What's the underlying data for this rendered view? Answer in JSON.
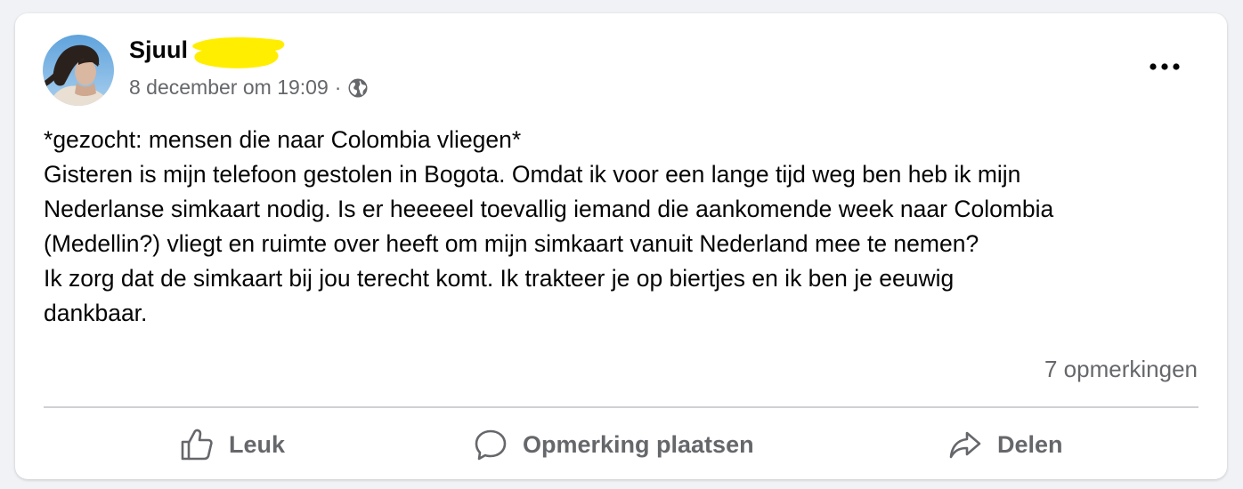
{
  "post": {
    "author": "Sjuul",
    "timestamp": "8 december om 19:09",
    "separator": "·",
    "privacy_icon": "globe-icon",
    "options_icon": "more-options-icon",
    "text_lines": [
      "*gezocht: mensen die naar Colombia vliegen*",
      "Gisteren is mijn telefoon gestolen in Bogota. Omdat ik voor een lange tijd weg ben heb ik mijn",
      "Nederlanse simkaart nodig. Is er heeeeel toevallig iemand die aankomende week naar Colombia",
      "(Medellin?) vliegt en ruimte over heeft om mijn simkaart vanuit Nederland mee te nemen?",
      "Ik zorg dat de simkaart bij jou terecht komt. Ik trakteer je op biertjes en ik ben je eeuwig",
      "dankbaar."
    ],
    "comments_count": "7 opmerkingen"
  },
  "actions": {
    "like": "Leuk",
    "comment": "Opmerking plaatsen",
    "share": "Delen"
  },
  "colors": {
    "background": "#f0f2f5",
    "card": "#ffffff",
    "text_primary": "#050505",
    "text_secondary": "#65676b",
    "divider": "#ced0d4",
    "redaction": "#ffee00"
  }
}
